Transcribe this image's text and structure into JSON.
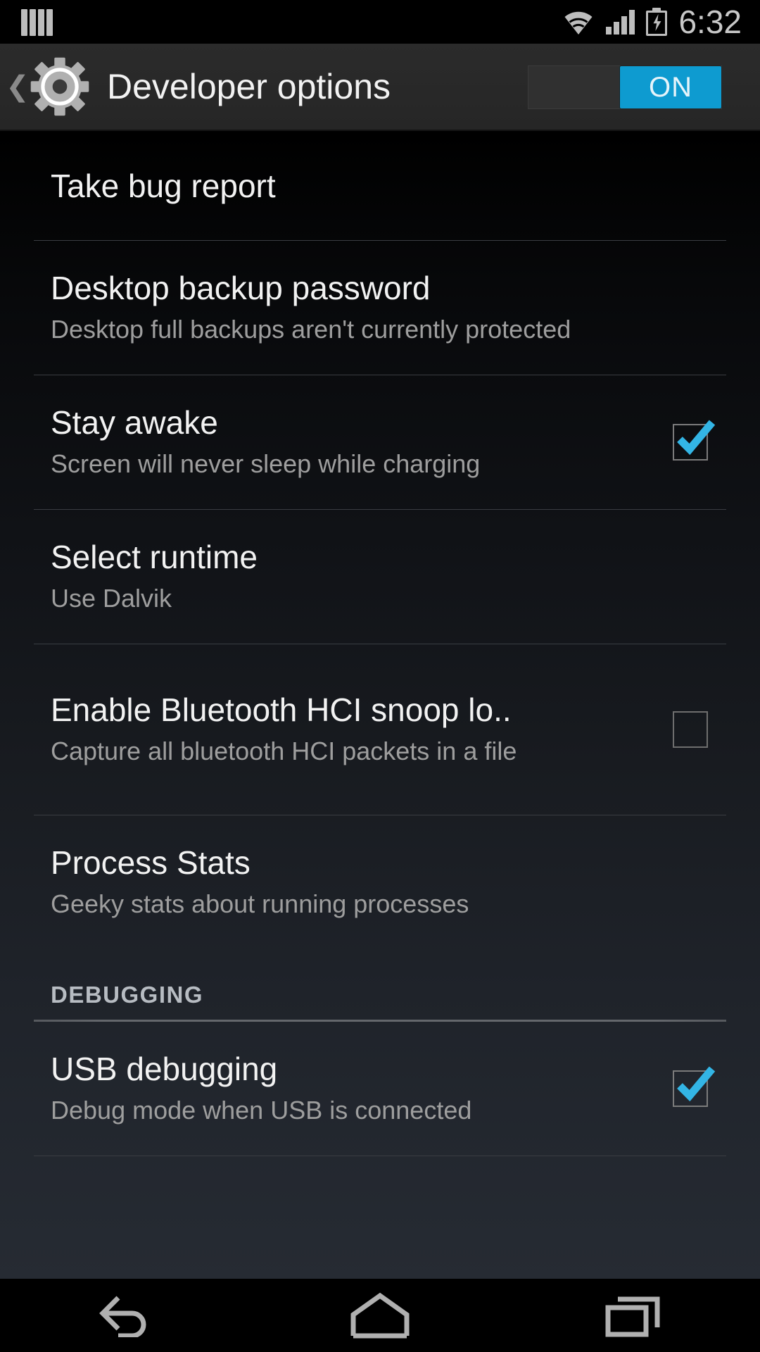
{
  "status_bar": {
    "notification_icon": "four-bars-icon",
    "wifi_icon": "wifi-icon",
    "signal_icon": "cellular-signal-icon",
    "battery_icon": "battery-charging-icon",
    "time": "6:32"
  },
  "action_bar": {
    "up_icon": "back-chevron-icon",
    "app_icon": "settings-gear-icon",
    "title": "Developer options",
    "switch_label": "ON",
    "switch_state": "on",
    "accent_color": "#0e9bd0"
  },
  "settings": [
    {
      "id": "take-bug-report",
      "title": "Take bug report",
      "summary": "",
      "control": "none"
    },
    {
      "id": "desktop-backup-password",
      "title": "Desktop backup password",
      "summary": "Desktop full backups aren't currently protected",
      "control": "none"
    },
    {
      "id": "stay-awake",
      "title": "Stay awake",
      "summary": "Screen will never sleep while charging",
      "control": "checkbox",
      "checked": true
    },
    {
      "id": "select-runtime",
      "title": "Select runtime",
      "summary": "Use Dalvik",
      "control": "none"
    },
    {
      "id": "enable-bluetooth-hci-snoop-log",
      "title": "Enable Bluetooth HCI snoop lo..",
      "summary": "Capture all bluetooth HCI packets in a file",
      "control": "checkbox",
      "checked": false
    },
    {
      "id": "process-stats",
      "title": "Process Stats",
      "summary": "Geeky stats about running processes",
      "control": "none"
    }
  ],
  "debugging_section": {
    "header": "DEBUGGING",
    "items": [
      {
        "id": "usb-debugging",
        "title": "USB debugging",
        "summary": "Debug mode when USB is connected",
        "control": "checkbox",
        "checked": true
      }
    ]
  },
  "nav_bar": {
    "back": "back-icon",
    "home": "home-icon",
    "recents": "recents-icon"
  },
  "colors": {
    "accent": "#33b5e5",
    "switch_on": "#0e9bd0",
    "title_text": "#f2f2f2",
    "summary_text": "#9e9e9e",
    "divider": "#3a3d42"
  }
}
